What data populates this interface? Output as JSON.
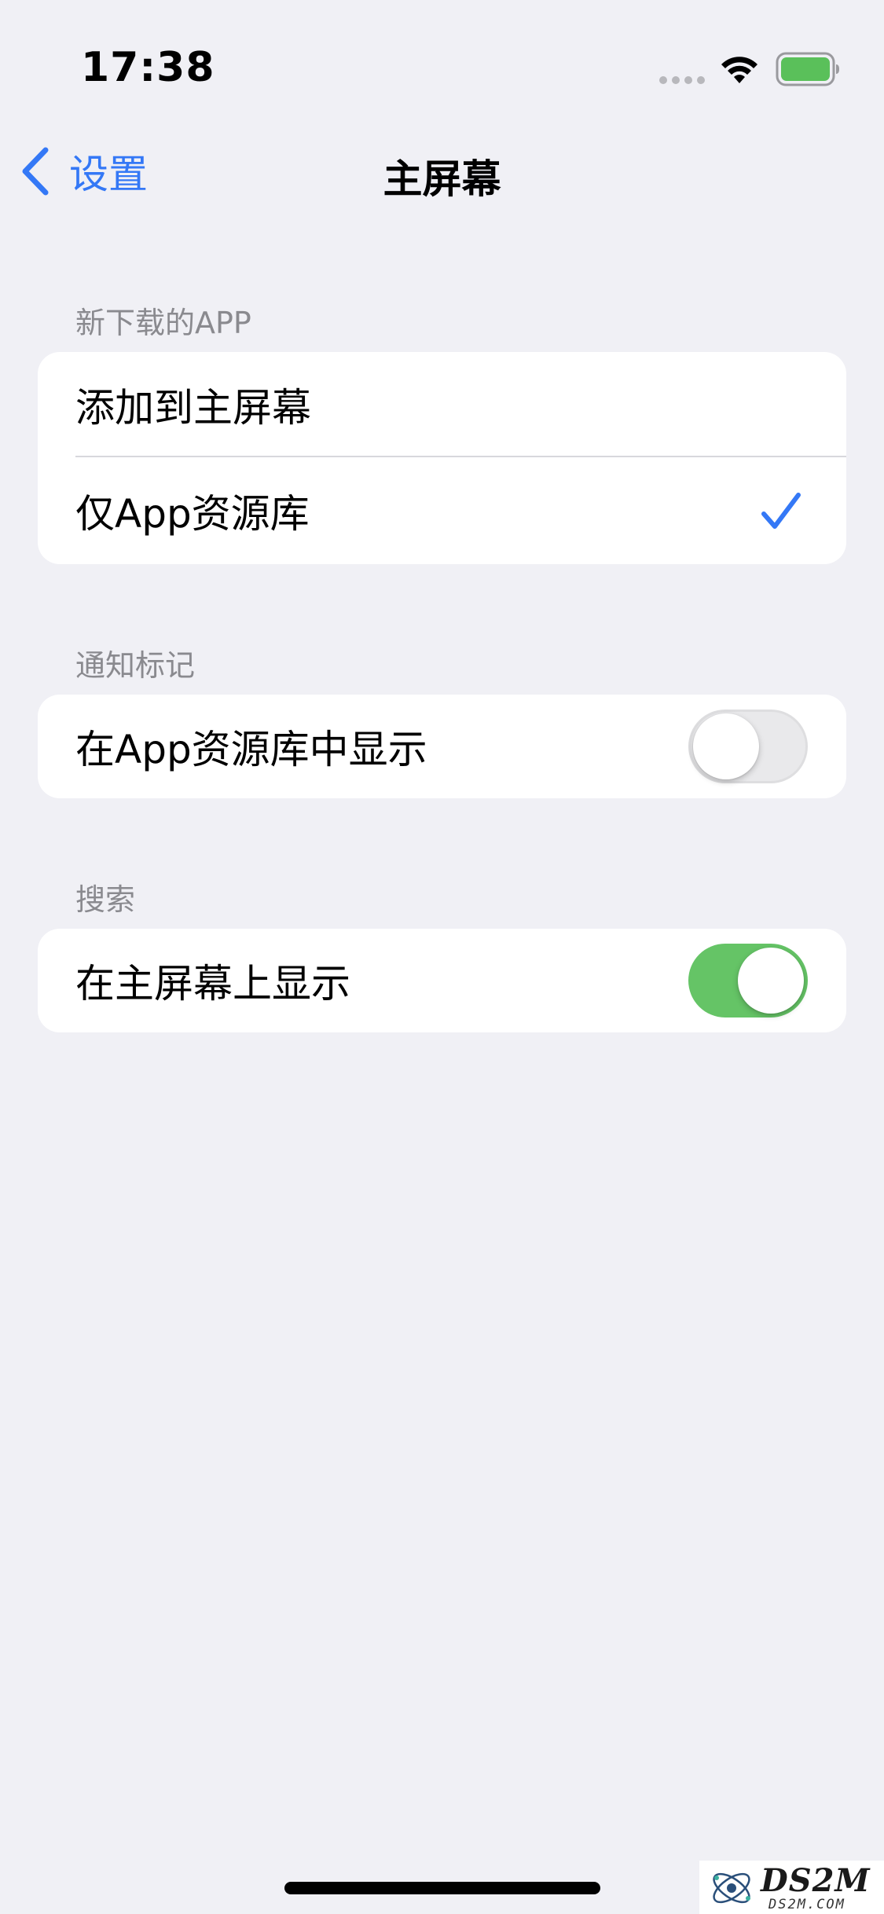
{
  "status_bar": {
    "time": "17:38",
    "signal_icon": "cellular-dots-icon",
    "wifi_icon": "wifi-icon",
    "battery_icon": "battery-icon",
    "battery_color": "#5ac05a"
  },
  "nav": {
    "back_label": "设置",
    "back_icon": "chevron-left-icon",
    "title": "主屏幕",
    "accent_color": "#3478f6"
  },
  "sections": {
    "new_apps": {
      "header": "新下载的APP",
      "options": [
        {
          "label": "添加到主屏幕",
          "selected": false
        },
        {
          "label": "仅App资源库",
          "selected": true
        }
      ]
    },
    "badges": {
      "header": "通知标记",
      "row_label": "在App资源库中显示",
      "toggle_on": false
    },
    "search": {
      "header": "搜索",
      "row_label": "在主屏幕上显示",
      "toggle_on": true,
      "toggle_color": "#65c466"
    }
  },
  "watermark": {
    "text": "DS2M",
    "sub": "DS2M.COM"
  }
}
